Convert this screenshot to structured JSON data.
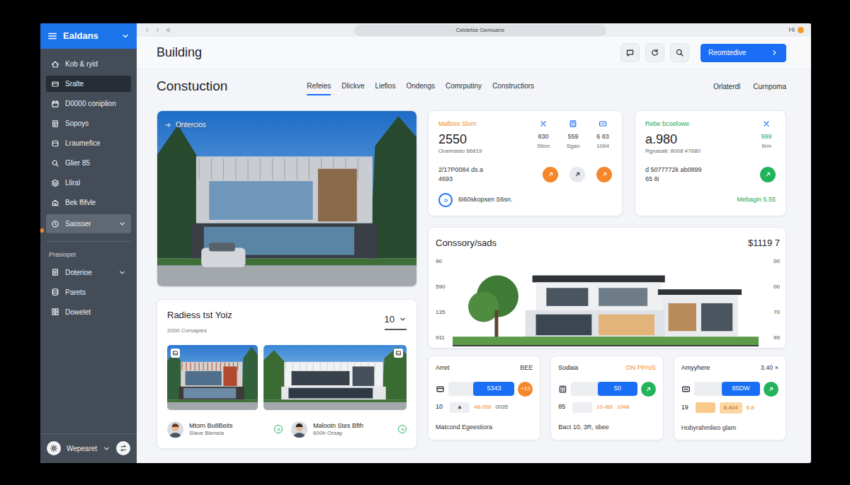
{
  "window": {
    "title": "Ceidetse Gemuans",
    "right_text": "Hi"
  },
  "sidebar": {
    "brand": "Ealdans",
    "items": [
      {
        "label": "Kob & ryid",
        "selected": false,
        "highlighted": false,
        "has_submenu": false
      },
      {
        "label": "Sralte",
        "selected": false,
        "highlighted": true,
        "has_submenu": false
      },
      {
        "label": "D0000 coniplion",
        "selected": false,
        "highlighted": false,
        "has_submenu": false
      },
      {
        "label": "Sopoys",
        "selected": false,
        "highlighted": false,
        "has_submenu": false
      },
      {
        "label": "Lraumefice",
        "selected": false,
        "highlighted": false,
        "has_submenu": false
      },
      {
        "label": "Glier 85",
        "selected": false,
        "highlighted": false,
        "has_submenu": false
      },
      {
        "label": "Lliral",
        "selected": false,
        "highlighted": false,
        "has_submenu": false
      },
      {
        "label": "Bek ffifvle",
        "selected": false,
        "highlighted": false,
        "has_submenu": false
      },
      {
        "label": "Saosser",
        "selected": true,
        "highlighted": false,
        "has_submenu": true
      }
    ],
    "section_title": "Prasiopet",
    "section_items": [
      {
        "label": "Doterioe",
        "selected": false,
        "highlighted": false,
        "has_submenu": true
      },
      {
        "label": "Parets",
        "selected": false,
        "highlighted": false,
        "has_submenu": false
      },
      {
        "label": "Dowelet",
        "selected": false,
        "highlighted": false,
        "has_submenu": false
      }
    ],
    "footer": "Wepearet"
  },
  "header": {
    "title": "Building",
    "action_button": "Reomtedive"
  },
  "page": {
    "title": "Constuction",
    "tabs": [
      {
        "label": "Refeies",
        "selected": true
      },
      {
        "label": "Dlickve",
        "selected": false
      },
      {
        "label": "Liefios",
        "selected": false
      },
      {
        "label": "Ondengs",
        "selected": false
      },
      {
        "label": "Comrputiny",
        "selected": false
      },
      {
        "label": "Constructiors",
        "selected": false
      }
    ],
    "right_links": [
      "Orlaterdl",
      "Curnpoma"
    ]
  },
  "hero": {
    "label": "Ontercios"
  },
  "gallery": {
    "title": "Radiess tst Yoiz",
    "subtitle": "2000 Corsapies",
    "count": "10",
    "people": [
      {
        "name": "Mtorn Bu8Beits",
        "role": "Slave Bieneia"
      },
      {
        "name": "Malootn Stes Bfth",
        "role": "600h Orsay"
      }
    ]
  },
  "stat_cards": [
    {
      "label": "Malbiss Slom",
      "label_color": "#f08a24",
      "value": "2550",
      "sub": "Ouemasto 66819",
      "minis": [
        {
          "value": "830",
          "label": "Stion",
          "color": "#2b3038"
        },
        {
          "value": "559",
          "label": "Sgan",
          "color": "#2b3038"
        },
        {
          "value": "6 83",
          "label": "1064",
          "color": "#2b3038"
        }
      ],
      "line1": "2/17P0084 ds.a",
      "line2": "4693",
      "dots": [
        {
          "color": "#f5862a"
        },
        {
          "color": "#e6e9ed"
        },
        {
          "color": "#f5862a"
        }
      ],
      "footer": "6I60skopsen S6sn.",
      "footer_kind": "icon",
      "footer_color": "#2a2f36"
    },
    {
      "label": "Rebe bcoelowe",
      "label_color": "#22a55a",
      "value": "a.980",
      "sub": "Rgxasatl: 8008 47680",
      "minis": [
        {
          "value": "999",
          "label": "9rm",
          "color": "#22a55a"
        }
      ],
      "line1": "d 5077772k ab0899",
      "line2": "65 8i",
      "dots": [
        {
          "color": "#22b45a"
        }
      ],
      "footer": "Mebagin 5.55",
      "footer_kind": "plain",
      "footer_color": "#22a55a"
    }
  ],
  "chart": {
    "title": "Conssory/sads",
    "value": "$1119 7",
    "y_left": [
      "90",
      "590",
      "135",
      "911"
    ],
    "y_right": [
      "00",
      "00",
      "70",
      "99"
    ]
  },
  "metric_cards": [
    {
      "title": "Arret",
      "tag": "BEE",
      "tag_color": "#2f353d",
      "bar": {
        "value": "5343",
        "level": 0.62
      },
      "badge": {
        "kind": "text",
        "text": "+13",
        "color": "#f5862a"
      },
      "num": "10",
      "row2": {
        "kind": "plain",
        "mark": "▲",
        "value": "48.058",
        "extra": "0035",
        "extra_color": "#555b62"
      },
      "footer": "Matcond Egeestiora"
    },
    {
      "title": "Sodaia",
      "tag": "ON PPAIS",
      "tag_color": "#f08a24",
      "bar": {
        "value": "50",
        "level": 0.6
      },
      "badge": {
        "kind": "icon",
        "color": "#22b45a"
      },
      "num": "85",
      "row2": {
        "kind": "plain",
        "value": "10-66I",
        "extra": "10MI",
        "extra_color": "#f08a24"
      },
      "footer": "Bact 10, 3R, sbee"
    },
    {
      "title": "Amyyhere",
      "tag": "3.40 ×",
      "tag_color": "#2f353d",
      "bar": {
        "value": "85DW",
        "level": 0.58
      },
      "badge": {
        "kind": "icon",
        "color": "#22b45a"
      },
      "num": "19",
      "row2": {
        "kind": "tinted",
        "value": "8.404",
        "extra": "6.8",
        "extra_color": "#f08a24"
      },
      "footer": "Hobyrahmlieo glam"
    }
  ]
}
